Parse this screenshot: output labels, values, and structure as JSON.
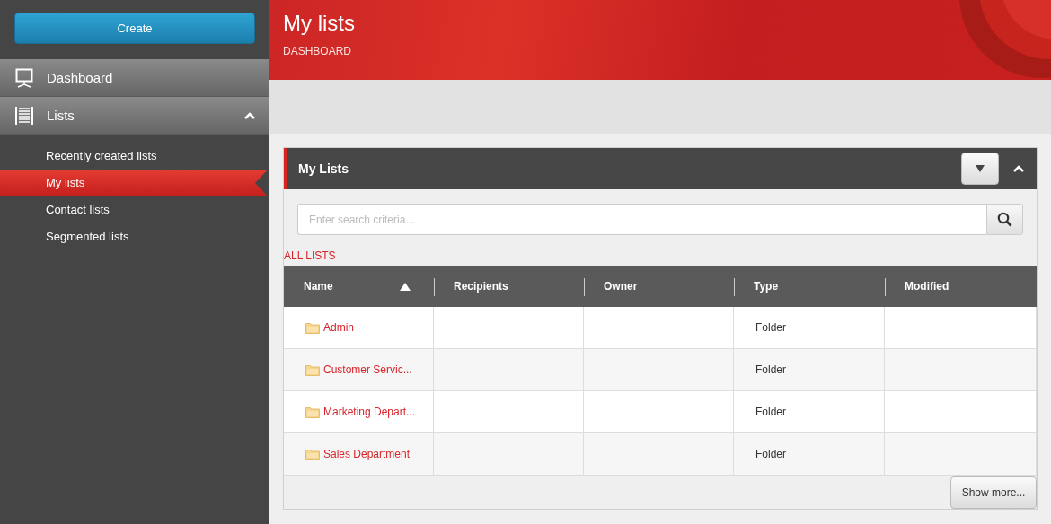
{
  "sidebar": {
    "create_button": "Create",
    "nav": [
      {
        "label": "Dashboard"
      },
      {
        "label": "Lists",
        "expanded": true
      }
    ],
    "subnav": [
      {
        "label": "Recently created lists",
        "selected": false
      },
      {
        "label": "My lists",
        "selected": true
      },
      {
        "label": "Contact lists",
        "selected": false
      },
      {
        "label": "Segmented lists",
        "selected": false
      }
    ]
  },
  "header": {
    "title": "My lists",
    "breadcrumb": "DASHBOARD"
  },
  "panel": {
    "title": "My Lists",
    "expanded": true,
    "search": {
      "placeholder": "Enter search criteria..."
    },
    "filter_label": "ALL LISTS",
    "table": {
      "columns": [
        {
          "label": "Name",
          "sorted": true
        },
        {
          "label": "Recipients",
          "sorted": false
        },
        {
          "label": "Owner",
          "sorted": false
        },
        {
          "label": "Type",
          "sorted": false
        },
        {
          "label": "Modified",
          "sorted": false
        }
      ],
      "rows": [
        {
          "name": "Admin",
          "type": "Folder"
        },
        {
          "name": "Customer Servic...",
          "type": "Folder"
        },
        {
          "name": "Marketing Depart...",
          "type": "Folder"
        },
        {
          "name": "Sales Department",
          "type": "Folder"
        }
      ]
    },
    "show_more_button": "Show more..."
  }
}
